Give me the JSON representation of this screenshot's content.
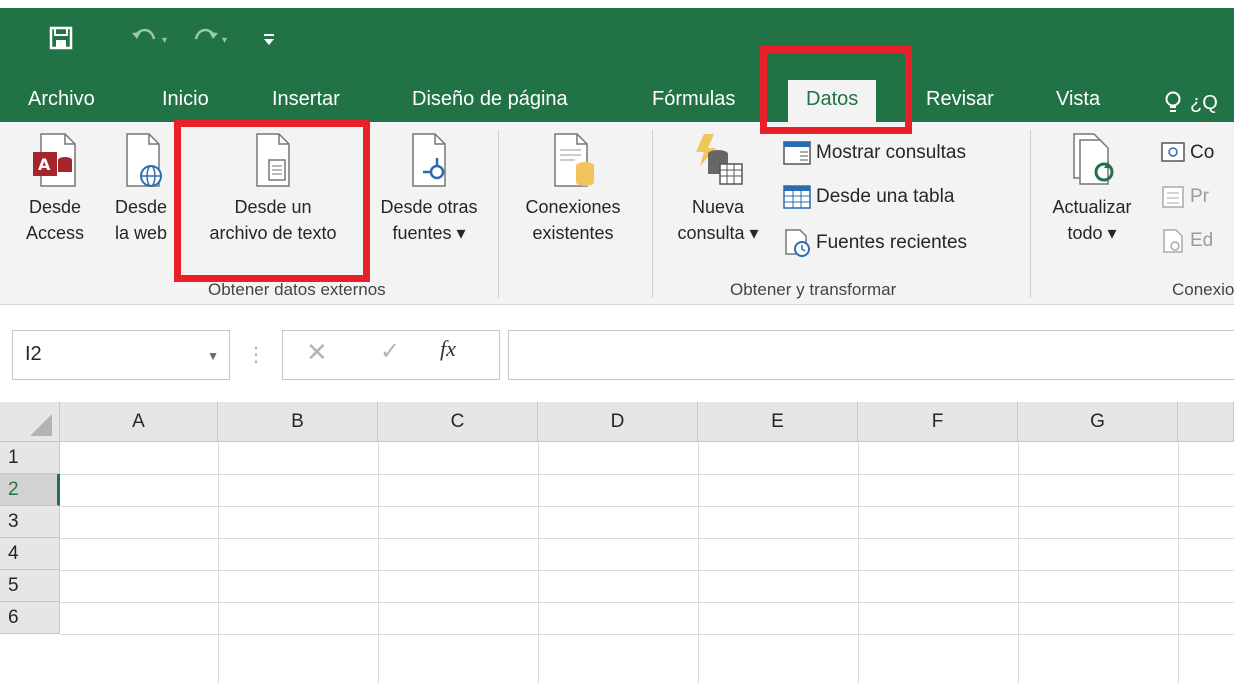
{
  "qat": {
    "save": "save-icon",
    "undo": "undo-icon",
    "redo": "redo-icon",
    "customize": "customize-qat-icon"
  },
  "tabs": [
    {
      "label": "Archivo"
    },
    {
      "label": "Inicio"
    },
    {
      "label": "Insertar"
    },
    {
      "label": "Diseño de página"
    },
    {
      "label": "Fórmulas"
    },
    {
      "label": "Datos"
    },
    {
      "label": "Revisar"
    },
    {
      "label": "Vista"
    },
    {
      "label": "¿Q"
    }
  ],
  "ribbon": {
    "get_external": {
      "label": "Obtener datos externos",
      "access": {
        "line1": "Desde",
        "line2": "Access"
      },
      "web": {
        "line1": "Desde",
        "line2": "la web"
      },
      "text": {
        "line1": "Desde un",
        "line2": "archivo de texto"
      },
      "other": {
        "line1": "Desde otras",
        "line2": "fuentes ▾"
      },
      "connections": {
        "line1": "Conexiones",
        "line2": "existentes"
      }
    },
    "get_transform": {
      "label": "Obtener y transformar",
      "new_query": {
        "line1": "Nueva",
        "line2": "consulta ▾"
      },
      "show_queries": "Mostrar consultas",
      "from_table": "Desde una tabla",
      "recent": "Fuentes recientes"
    },
    "connections": {
      "label": "Conexio",
      "refresh": {
        "line1": "Actualizar",
        "line2": "todo ▾"
      },
      "c1": "Co",
      "c2": "Pr",
      "c3": "Ed"
    }
  },
  "formula_bar": {
    "name_box": "I2",
    "fx": "fx"
  },
  "grid": {
    "columns": [
      "A",
      "B",
      "C",
      "D",
      "E",
      "F",
      "G"
    ],
    "rows": [
      "1",
      "2",
      "3",
      "4",
      "5",
      "6"
    ],
    "selected_row": "2"
  },
  "colors": {
    "accent": "#217346",
    "highlight": "#e8202a"
  }
}
